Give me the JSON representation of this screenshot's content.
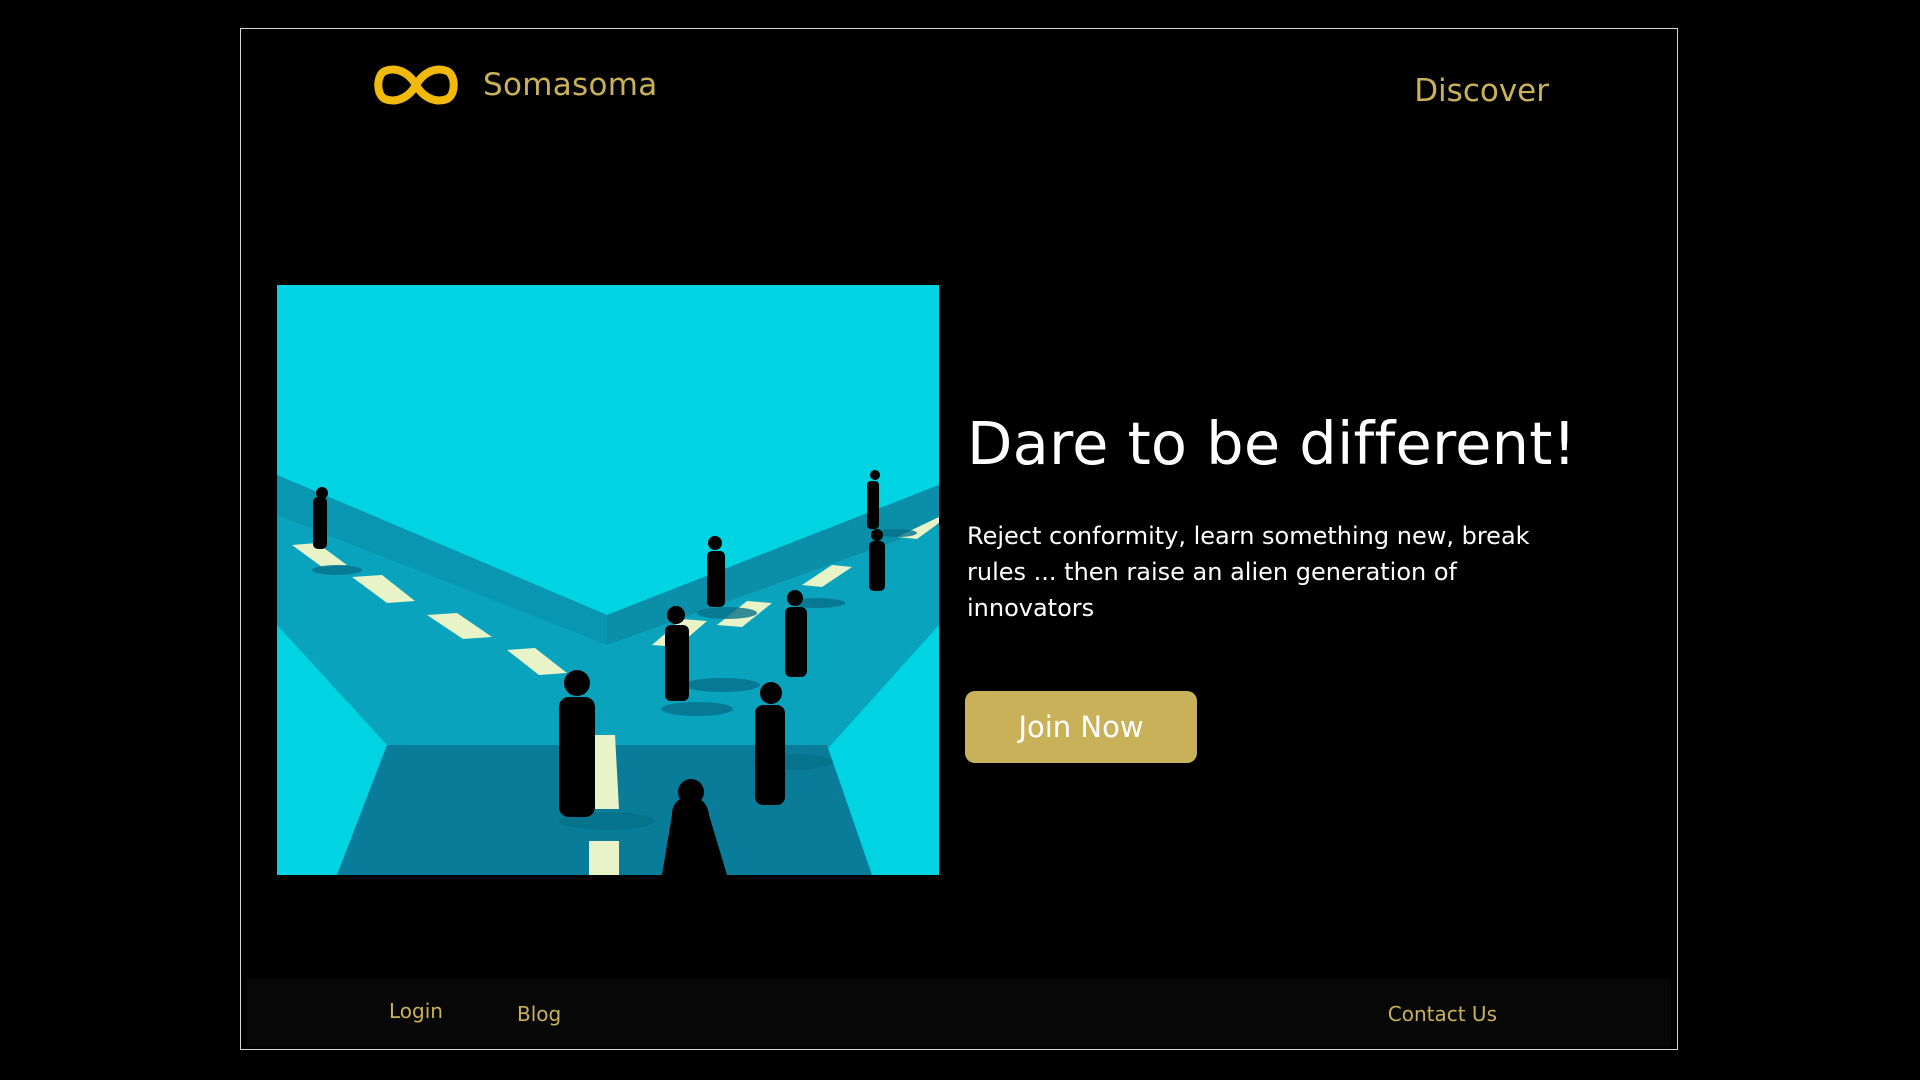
{
  "header": {
    "brand": "Somasoma",
    "logo_icon": "infinity-icon",
    "nav_discover": "Discover"
  },
  "hero": {
    "image_description_icon": "crossroads-illustration",
    "headline": "Dare to be different!",
    "subtext": "Reject conformity, learn something new, break rules ... then raise an alien generation of innovators",
    "cta_label": "Join Now"
  },
  "footer": {
    "login": "Login",
    "blog": "Blog",
    "contact": "Contact Us"
  },
  "colors": {
    "background": "#000000",
    "accent": "#c9b15a",
    "logo": "#f0b90b",
    "illustration_sky": "#00d4e2",
    "road": "#0aa3bd"
  }
}
